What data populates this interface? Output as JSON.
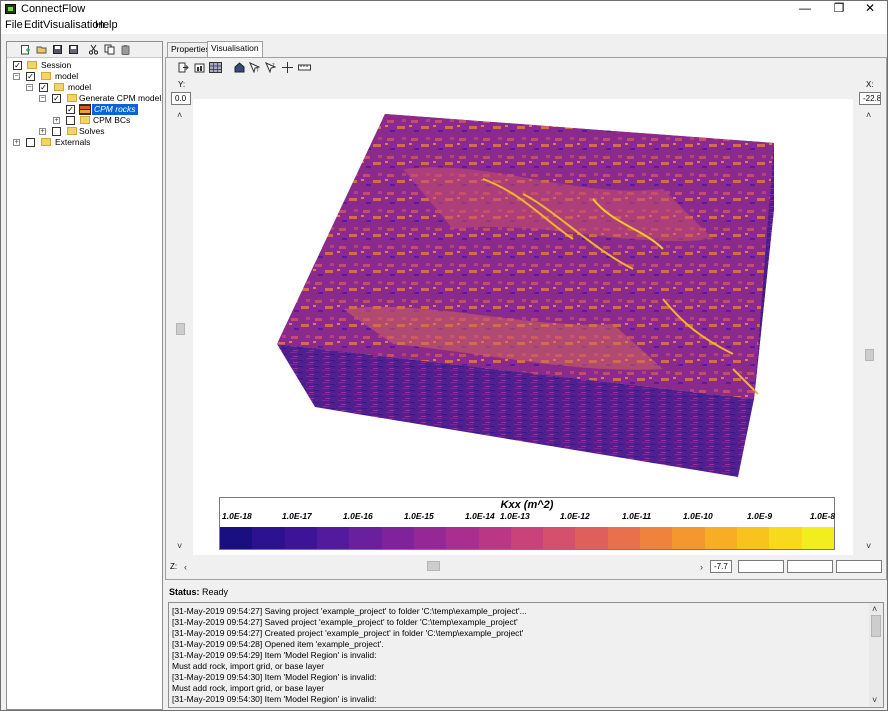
{
  "window": {
    "title": "ConnectFlow",
    "minimize": "—",
    "restore": "❐",
    "close": "✕"
  },
  "menu": [
    "File",
    "Edit",
    "Visualisation",
    "Help"
  ],
  "tree": {
    "session": "Session",
    "model_root": "model",
    "model": "model",
    "generate": "Generate CPM model",
    "cpm_rocks": "CPM rocks",
    "cpm_bcs": "CPM BCs",
    "solves": "Solves",
    "externals": "Externals"
  },
  "tabs": {
    "properties": "Properties",
    "visualisation": "Visualisation"
  },
  "viewer": {
    "y_label": "Y:",
    "y_value": "0.0",
    "x_label": "X:",
    "x_value": "-22.8",
    "z_label": "Z:",
    "z_value": "-7.7"
  },
  "legend": {
    "title": "Kxx (m^2)",
    "ticks": [
      "1.0E-18",
      "1.0E-17",
      "1.0E-16",
      "1.0E-15",
      "1.0E-14",
      "1.0E-13",
      "1.0E-12",
      "1.0E-11",
      "1.0E-10",
      "1.0E-9",
      "1.0E-8"
    ],
    "colors": [
      "#1a0f80",
      "#2c1190",
      "#3d1498",
      "#531a9e",
      "#6a1f9f",
      "#7f229c",
      "#952797",
      "#a92e90",
      "#ba3786",
      "#c9427a",
      "#d5506c",
      "#df5f5d",
      "#e8704d",
      "#ef833e",
      "#f4972f",
      "#f8ad24",
      "#f9c31d",
      "#f7da1b",
      "#f2ee1e"
    ]
  },
  "status": {
    "label": "Status:",
    "value": "Ready"
  },
  "log": [
    "[31-May-2019 09:54:27] Saving project 'example_project' to folder 'C:\\temp\\example_project'...",
    "[31-May-2019 09:54:27] Saved project 'example_project' to folder 'C:\\temp\\example_project'",
    "[31-May-2019 09:54:27] Created project 'example_project' in folder 'C:\\temp\\example_project'",
    "[31-May-2019 09:54:28] Opened item 'example_project'.",
    "[31-May-2019 09:54:29] Item 'Model Region' is invalid:",
    "Must add rock, import grid, or base layer",
    "[31-May-2019 09:54:30] Item 'Model Region' is invalid:",
    "Must add rock, import grid, or base layer",
    "[31-May-2019 09:54:30] Item 'Model Region' is invalid:"
  ]
}
